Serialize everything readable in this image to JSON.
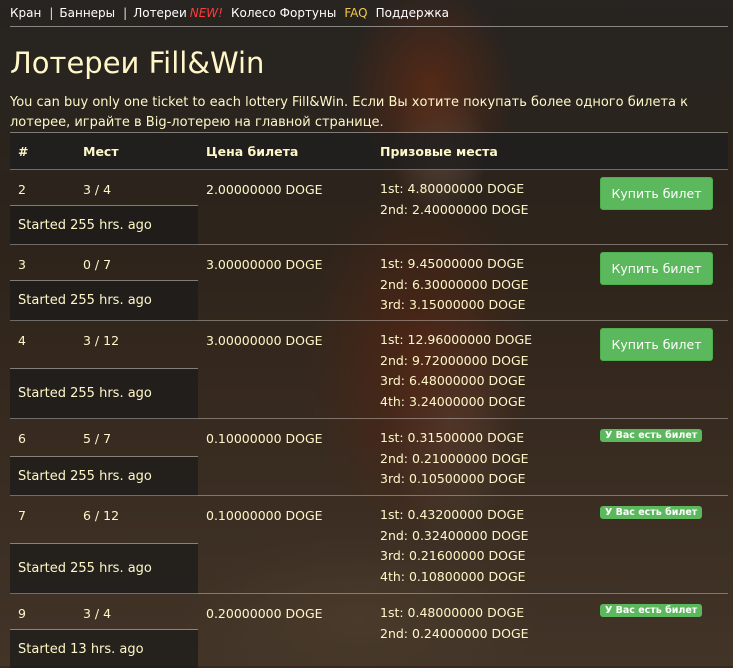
{
  "nav": {
    "items": [
      "Кран",
      "Баннеры",
      "Лотереи"
    ],
    "new_label": "NEW!",
    "fortune": "Колесо Фортуны",
    "faq": "FAQ",
    "support": "Поддержка"
  },
  "page": {
    "title": "Лотереи Fill&Win",
    "intro": "You can buy only one ticket to each lottery Fill&Win. Если Вы хотите покупать более одного билета к лотерее, играйте в Big-лотерею на главной странице."
  },
  "table": {
    "headers": [
      "#",
      "Мест",
      "Цена билета",
      "Призовые места"
    ],
    "buy_label": "Купить билет",
    "has_ticket_label": "У Вас есть билет",
    "rows": [
      {
        "id": "2",
        "places": "3 / 4",
        "price": "2.00000000 DOGE",
        "prizes": [
          "1st: 4.80000000 DOGE",
          "2nd: 2.40000000 DOGE"
        ],
        "started": "Started 255 hrs. ago",
        "status": "buy"
      },
      {
        "id": "3",
        "places": "0 / 7",
        "price": "3.00000000 DOGE",
        "prizes": [
          "1st: 9.45000000 DOGE",
          "2nd: 6.30000000 DOGE",
          "3rd: 3.15000000 DOGE"
        ],
        "started": "Started 255 hrs. ago",
        "status": "buy"
      },
      {
        "id": "4",
        "places": "3 / 12",
        "price": "3.00000000 DOGE",
        "prizes": [
          "1st: 12.96000000 DOGE",
          "2nd: 9.72000000 DOGE",
          "3rd: 6.48000000 DOGE",
          "4th: 3.24000000 DOGE"
        ],
        "started": "Started 255 hrs. ago",
        "status": "buy"
      },
      {
        "id": "6",
        "places": "5 / 7",
        "price": "0.10000000 DOGE",
        "prizes": [
          "1st: 0.31500000 DOGE",
          "2nd: 0.21000000 DOGE",
          "3rd: 0.10500000 DOGE"
        ],
        "started": "Started 255 hrs. ago",
        "status": "has"
      },
      {
        "id": "7",
        "places": "6 / 12",
        "price": "0.10000000 DOGE",
        "prizes": [
          "1st: 0.43200000 DOGE",
          "2nd: 0.32400000 DOGE",
          "3rd: 0.21600000 DOGE",
          "4th: 0.10800000 DOGE"
        ],
        "started": "Started 255 hrs. ago",
        "status": "has"
      },
      {
        "id": "9",
        "places": "3 / 4",
        "price": "0.20000000 DOGE",
        "prizes": [
          "1st: 0.48000000 DOGE",
          "2nd: 0.24000000 DOGE"
        ],
        "started": "Started 13 hrs. ago",
        "status": "has"
      }
    ]
  }
}
